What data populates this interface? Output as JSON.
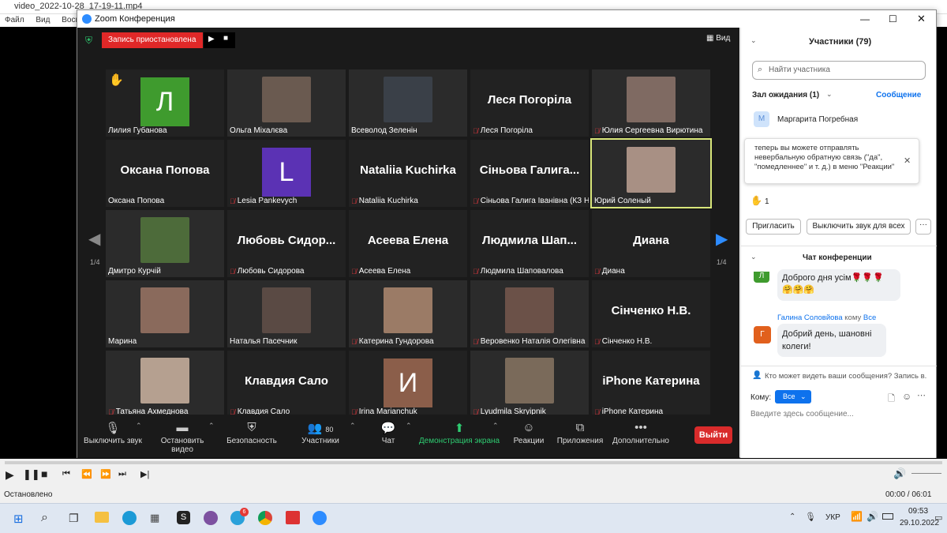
{
  "player": {
    "title": "video_2022-10-28_17-19-11.mp4",
    "menu": [
      "Файл",
      "Вид",
      "Воспро"
    ],
    "status": "Остановлено",
    "time": "00:00 / 06:01"
  },
  "zoom": {
    "window_title": "Zoom Конференция",
    "recording_label": "Запись приостановлена",
    "view_label": "Вид",
    "page_left": "1/4",
    "page_right": "1/4",
    "tiles": [
      {
        "name": "Лилия Губанова",
        "avatar": "Л",
        "color": "#3f9b2e",
        "raised_hand": true
      },
      {
        "name": "Ольга Міхалєва",
        "photo": true
      },
      {
        "name": "Всеволод Зеленін",
        "photo": true
      },
      {
        "name": "Леся Погоріла",
        "big": "Леся Погоріла",
        "muted": true
      },
      {
        "name": "Юлия Сергеевна Вирютина",
        "photo": true,
        "muted": true
      },
      {
        "name": "Оксана Попова",
        "big": "Оксана Попова"
      },
      {
        "name": "Lesia Pankevych",
        "avatar": "L",
        "color": "#5b32b4",
        "muted": true
      },
      {
        "name": "Nataliia Kuchirka",
        "big": "Nataliia Kuchirka",
        "muted": true
      },
      {
        "name": "Сіньова Галига Іванівна (КЗ НД...",
        "big": "Сіньова Галига...",
        "muted": true
      },
      {
        "name": "Юрий Соленый",
        "photo": true,
        "active": true
      },
      {
        "name": "Дмитро Курчій",
        "photo": true
      },
      {
        "name": "Любовь Сидорова",
        "big": "Любовь Сидор...",
        "muted": true
      },
      {
        "name": "Асеева Елена",
        "big": "Асеева Елена",
        "muted": true
      },
      {
        "name": "Людмила Шаповалова",
        "big": "Людмила Шап...",
        "muted": true
      },
      {
        "name": "Диана",
        "big": "Диана",
        "muted": true
      },
      {
        "name": "Марина",
        "photo": true
      },
      {
        "name": "Наталья Пасечник",
        "photo": true
      },
      {
        "name": "Катерина Гундорова",
        "photo": true,
        "muted": true
      },
      {
        "name": "Веровенко Наталія Олегівна",
        "photo": true,
        "muted": true
      },
      {
        "name": "Сінченко Н.В.",
        "big": "Сінченко Н.В.",
        "muted": true
      },
      {
        "name": "Татьяна Ахмеднова",
        "photo": true,
        "muted": true
      },
      {
        "name": "Клавдия Сало",
        "big": "Клавдия Сало",
        "muted": true
      },
      {
        "name": "Irina Marianchuk",
        "avatar": "И",
        "color": "#8b5e4a",
        "muted": true
      },
      {
        "name": "Lyudmila Skryipnik",
        "photo": true,
        "muted": true
      },
      {
        "name": "iPhone Катерина",
        "big": "iPhone Катерина",
        "muted": true
      }
    ],
    "toolbar": {
      "mute": "Выключить звук",
      "video": "Остановить видео",
      "security": "Безопасность",
      "participants": "Участники",
      "participants_count": "80",
      "chat": "Чат",
      "share": "Демонстрация экрана",
      "reactions": "Реакции",
      "apps": "Приложения",
      "more": "Дополнительно",
      "leave": "Выйти"
    },
    "panel": {
      "participants_title": "Участники (79)",
      "search_placeholder": "Найти участника",
      "waiting_room": "Зал ожидания (1)",
      "message_link": "Сообщение",
      "waiting_person_initial": "М",
      "waiting_person": "Маргарита Погребная",
      "tip": "теперь вы можете отправлять невербальную обратную связь (\"да\", \"помедленнее\" и т. д.) в меню \"Реакции\"",
      "raised_hands_count": "1",
      "invite": "Пригласить",
      "mute_all": "Выключить звук для всех",
      "more": "···",
      "chat_title": "Чат конференции",
      "chat_msg1_initial": "Л",
      "chat_msg1_text": "Доброго дня усім🌹🌹🌹 🤗🤗🤗",
      "chat_msg2_sender": "Галина Соловйова",
      "chat_msg2_to_prefix": "кому",
      "chat_msg2_to": "Все",
      "chat_msg2_initial": "Г",
      "chat_msg2_text": "Добрий день, шановні колеги!",
      "who_can_see": "Кто может видеть ваши сообщения? Запись в...",
      "to_label": "Кому:",
      "to_value": "Все",
      "input_placeholder": "Введите здесь сообщение..."
    }
  },
  "taskbar": {
    "lang": "УКР",
    "time": "09:53",
    "date": "29.10.2022",
    "telegram_badge": "6"
  }
}
